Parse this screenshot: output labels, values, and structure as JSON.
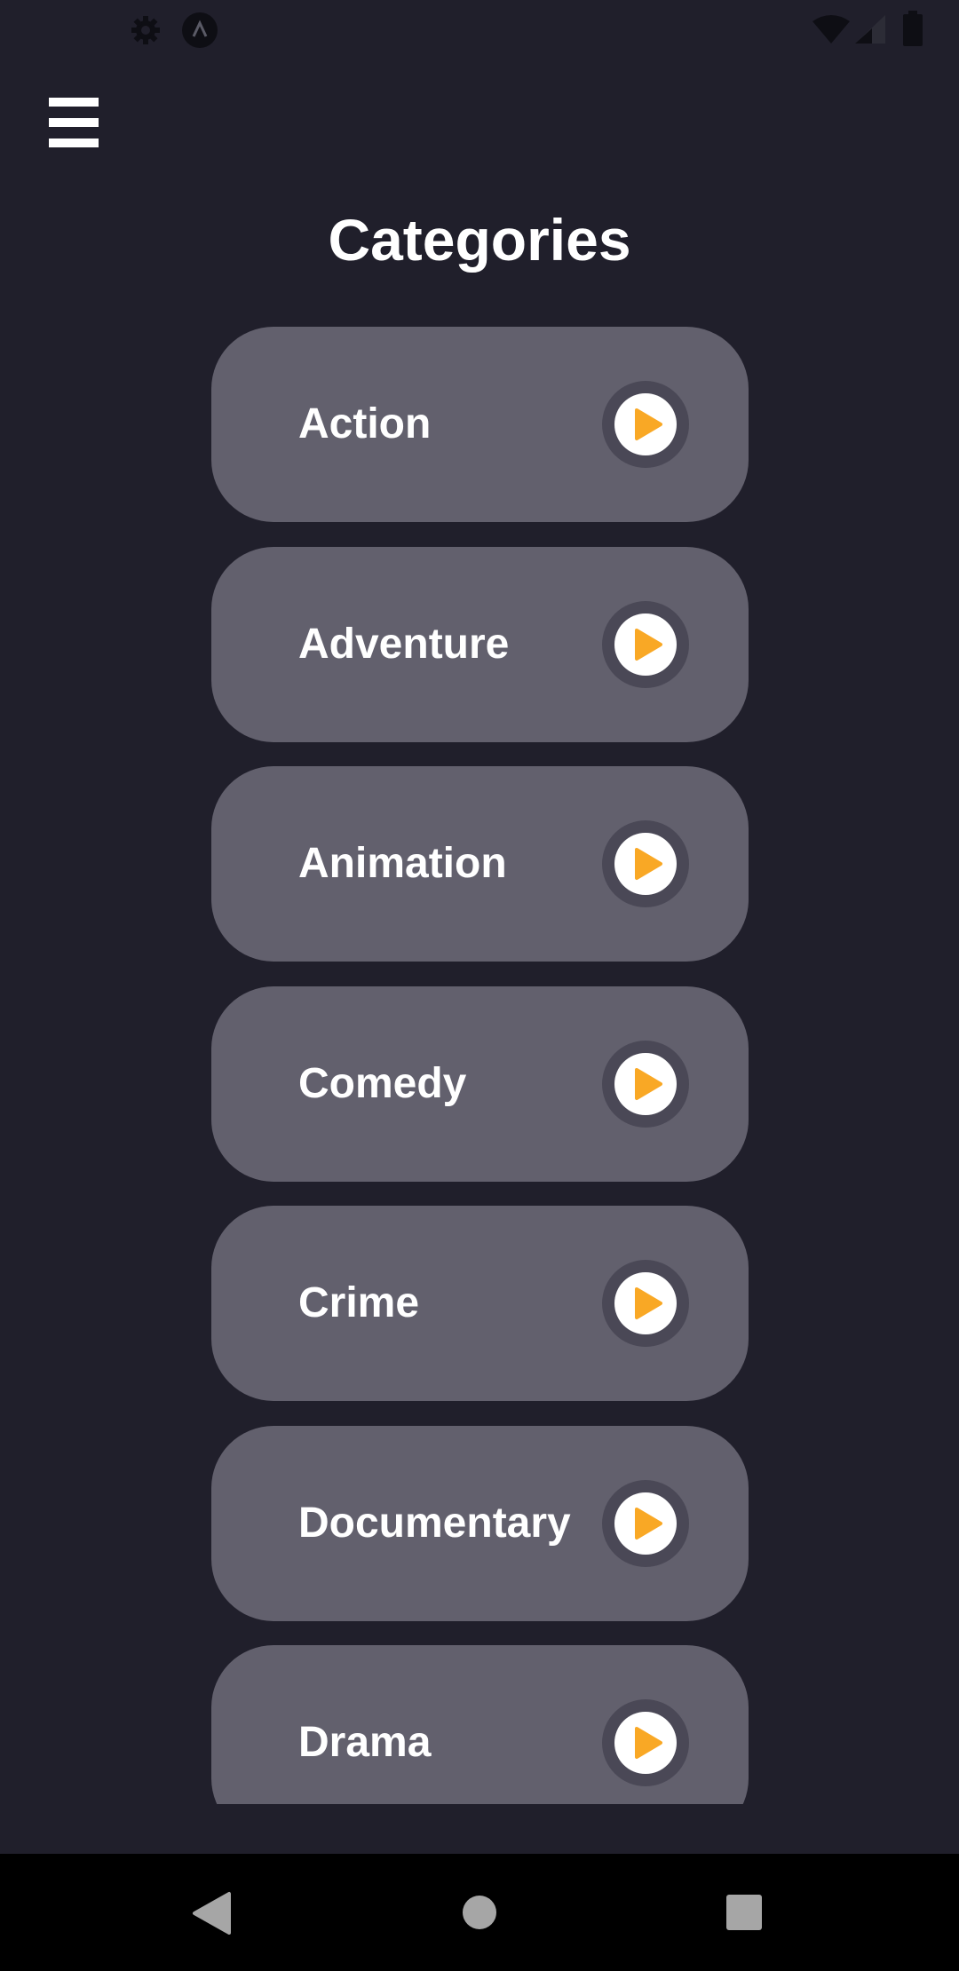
{
  "status_bar": {
    "left_icons": [
      "gear-icon",
      "app-badge-icon"
    ],
    "right_icons": [
      "wifi-icon",
      "signal-icon",
      "battery-icon"
    ]
  },
  "header": {
    "menu_icon": "hamburger-menu-icon",
    "title": "Categories"
  },
  "categories": [
    {
      "label": "Action"
    },
    {
      "label": "Adventure"
    },
    {
      "label": "Animation"
    },
    {
      "label": "Comedy"
    },
    {
      "label": "Crime"
    },
    {
      "label": "Documentary"
    },
    {
      "label": "Drama"
    }
  ],
  "colors": {
    "background": "#201f2b",
    "card": "#62606d",
    "play_ring": "#4a4856",
    "accent": "#f9a825",
    "text": "#ffffff",
    "nav_bar": "#000000"
  },
  "nav_bar": {
    "buttons": [
      "back-icon",
      "home-icon",
      "recents-icon"
    ]
  }
}
